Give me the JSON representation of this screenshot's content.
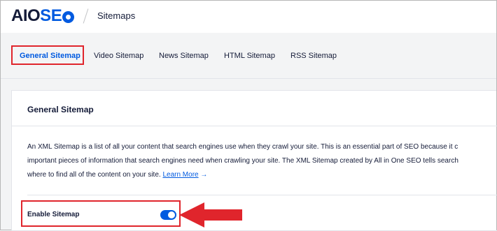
{
  "header": {
    "logo_aio": "AIO",
    "logo_s": "S",
    "logo_e": "E",
    "logo_o": "O",
    "breadcrumb": "Sitemaps"
  },
  "tabs": [
    {
      "label": "General Sitemap",
      "active": true
    },
    {
      "label": "Video Sitemap",
      "active": false
    },
    {
      "label": "News Sitemap",
      "active": false
    },
    {
      "label": "HTML Sitemap",
      "active": false
    },
    {
      "label": "RSS Sitemap",
      "active": false
    }
  ],
  "card": {
    "title": "General Sitemap",
    "description_line1": "An XML Sitemap is a list of all your content that search engines use when they crawl your site. This is an essential part of SEO because it c",
    "description_line2": "important pieces of information that search engines need when crawling your site. The XML Sitemap created by All in One SEO tells search",
    "description_line3": "where to find all of the content on your site.",
    "learn_more": "Learn More",
    "learn_more_arrow": "→"
  },
  "settings": {
    "enable_sitemap_label": "Enable Sitemap",
    "enable_sitemap_on": true
  },
  "colors": {
    "accent": "#005ae0",
    "highlight_red": "#e0252c",
    "text": "#141b38"
  },
  "icons": {
    "logo_gear": "gear-icon",
    "annotation_arrow": "red-arrow-left-icon"
  }
}
